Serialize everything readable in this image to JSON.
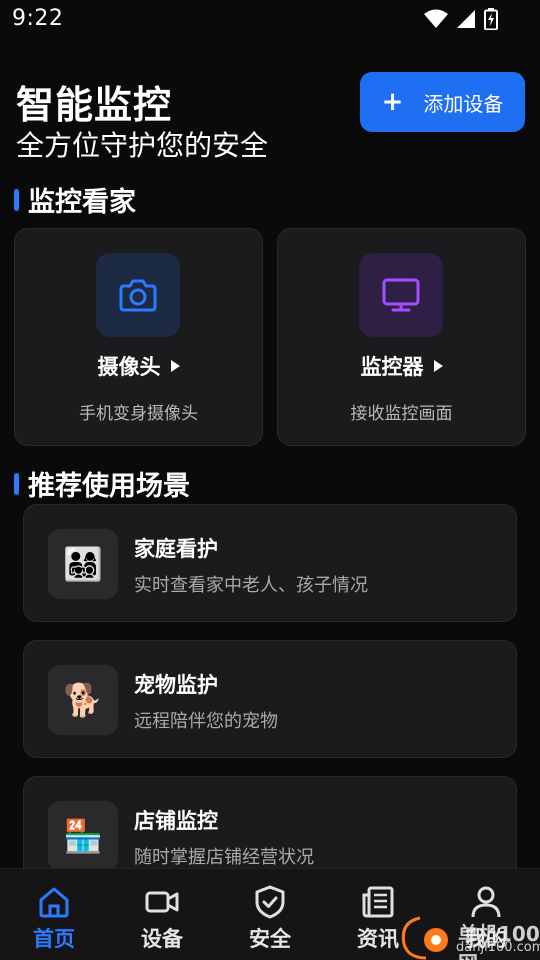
{
  "status_bar": {
    "time": "9:22"
  },
  "header": {
    "title": "智能监控",
    "subtitle": "全方位守护您的安全",
    "add_button": {
      "plus": "+",
      "label": "添加设备"
    }
  },
  "sections": {
    "monitor_home": "监控看家",
    "scenarios": "推荐使用场景"
  },
  "features": [
    {
      "label": "摄像头",
      "desc": "手机变身摄像头",
      "icon": "camera-icon",
      "color": "#2b7bff"
    },
    {
      "label": "监控器",
      "desc": "接收监控画面",
      "icon": "monitor-icon",
      "color": "#a64dff"
    }
  ],
  "scenarios": [
    {
      "title": "家庭看护",
      "desc": "实时查看家中老人、孩子情况",
      "icon": "family-icon",
      "emoji": "👨‍👩‍👧‍👦"
    },
    {
      "title": "宠物监护",
      "desc": "远程陪伴您的宠物",
      "icon": "dog-icon",
      "emoji": "🐕"
    },
    {
      "title": "店铺监控",
      "desc": "随时掌握店铺经营状况",
      "icon": "store-icon",
      "emoji": "🏪"
    }
  ],
  "bottom_nav": [
    {
      "label": "首页",
      "icon": "home-icon",
      "active": true
    },
    {
      "label": "设备",
      "icon": "video-camera-icon",
      "active": false
    },
    {
      "label": "安全",
      "icon": "shield-icon",
      "active": false
    },
    {
      "label": "资讯",
      "icon": "news-icon",
      "active": false
    },
    {
      "label": "我的",
      "icon": "user-icon",
      "active": false
    }
  ],
  "watermark": {
    "text": "单机100网",
    "sub": "danji100.com"
  },
  "colors": {
    "accent": "#2b7bff",
    "button": "#1f6ff2",
    "purple": "#a64dff",
    "background": "#0a0a0a",
    "card": "#1b1b1d"
  }
}
